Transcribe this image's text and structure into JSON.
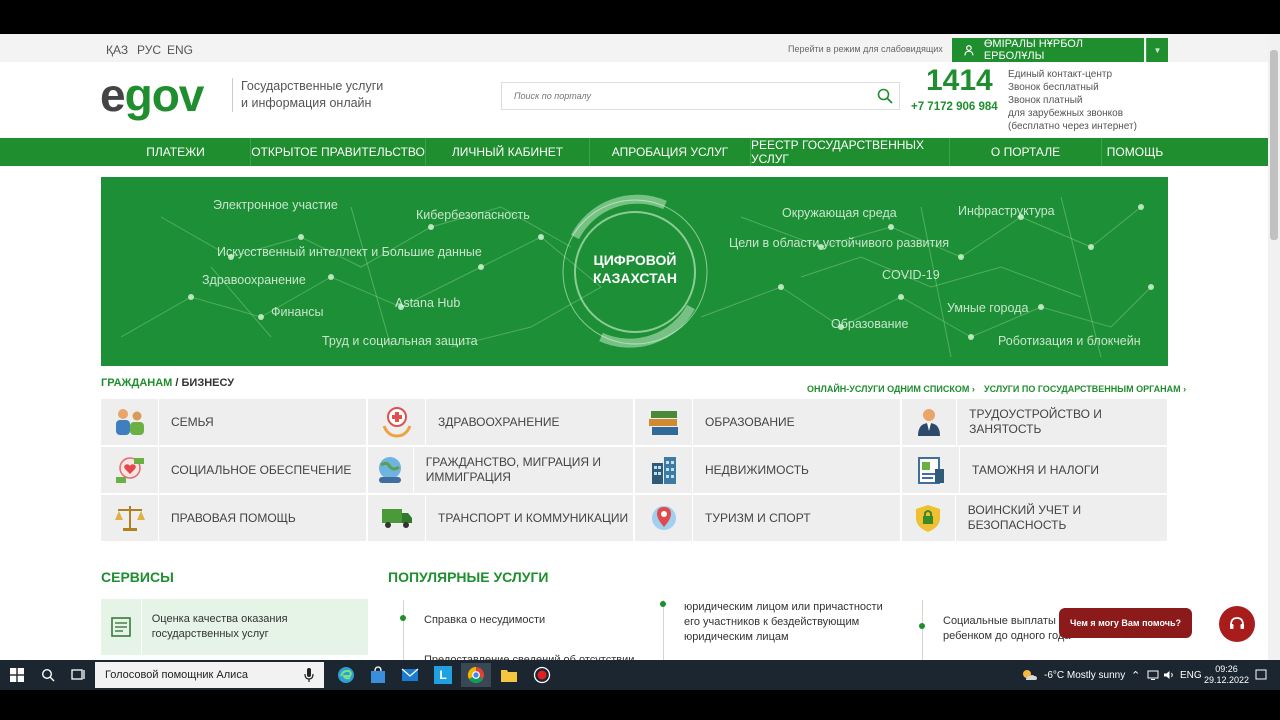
{
  "topbar": {
    "languages": [
      "ҚАЗ",
      "РУС",
      "ENG"
    ],
    "accessible_link": "Перейти в режим для слабовидящих",
    "user_name": "ӨМІРАЛЫ НҰРБОЛ ЕРБОЛҰЛЫ"
  },
  "header": {
    "logo_e": "e",
    "logo_gov": "gov",
    "subtitle_line1": "Государственные услуги",
    "subtitle_line2": "и информация онлайн",
    "search_placeholder": "Поиск по порталу",
    "phone_short": "1414",
    "phone_long": "+7 7172 906 984",
    "phone_info": [
      "Единый контакт-центр",
      "Звонок бесплатный",
      "Звонок платный",
      "для зарубежных звонков",
      "(бесплатно через интернет)"
    ]
  },
  "nav": [
    "ПЛАТЕЖИ",
    "ОТКРЫТОЕ ПРАВИТЕЛЬСТВО",
    "ЛИЧНЫЙ КАБИНЕТ",
    "АПРОБАЦИЯ УСЛУГ",
    "РЕЕСТР ГОСУДАРСТВЕННЫХ УСЛУГ",
    "О ПОРТАЛЕ",
    "ПОМОЩЬ"
  ],
  "banner": {
    "center_line1": "ЦИФРОВОЙ",
    "center_line2": "КАЗАХСТАН",
    "words": [
      "Электронное участие",
      "Кибербезопасность",
      "Искусственный интеллект и Большие данные",
      "Здравоохранение",
      "Финансы",
      "Astana Hub",
      "Труд и социальная защита",
      "Окружающая среда",
      "Инфраструктура",
      "Цели в области устойчивого развития",
      "COVID-19",
      "Умные города",
      "Образование",
      "Роботизация и блокчейн"
    ]
  },
  "citizens": {
    "title_a": "ГРАЖДАНАМ",
    "title_sep": " / ",
    "title_b": "БИЗНЕСУ",
    "link_online": "ОНЛАЙН-УСЛУГИ ОДНИМ СПИСКОМ ›",
    "link_agencies": "УСЛУГИ ПО ГОСУДАРСТВЕННЫМ ОРГАНАМ ›",
    "categories": [
      {
        "label": "Семья",
        "icon": "family-icon"
      },
      {
        "label": "Здравоохранение",
        "icon": "health-icon"
      },
      {
        "label": "Образование",
        "icon": "books-icon"
      },
      {
        "label": "Трудоустройство и занятость",
        "icon": "worker-icon"
      },
      {
        "label": "Социальное обеспечение",
        "icon": "social-icon"
      },
      {
        "label": "Гражданство, миграция и иммиграция",
        "icon": "globe-people-icon"
      },
      {
        "label": "Недвижимость",
        "icon": "building-icon"
      },
      {
        "label": "Таможня и налоги",
        "icon": "customs-icon"
      },
      {
        "label": "Правовая помощь",
        "icon": "scales-icon"
      },
      {
        "label": "Транспорт и коммуникации",
        "icon": "truck-icon"
      },
      {
        "label": "Туризм и спорт",
        "icon": "map-pin-icon"
      },
      {
        "label": "Воинский учет и безопасность",
        "icon": "shield-lock-icon"
      }
    ]
  },
  "services": {
    "title": "СЕРВИСЫ",
    "item": "Оценка качества оказания государственных услуг"
  },
  "popular": {
    "title": "ПОПУЛЯРНЫЕ УСЛУГИ",
    "items": [
      "Справка о несудимости",
      "Предоставление сведений об отсутствии",
      "юридическим лицом или причастности его участников к бездействующим юридическим лицам",
      "Социальные выплаты",
      "ребенком до одного года"
    ]
  },
  "chat": {
    "bubble": "Чем я могу Вам помочь?"
  },
  "taskbar": {
    "search_text": "Голосовой помощник Алиса",
    "weather": "-6°C  Mostly sunny",
    "lang": "ENG",
    "time": "09:26",
    "date": "29.12.2022"
  },
  "colors": {
    "brand_green": "#1f8e2e",
    "chat_red": "#a81c1c"
  }
}
